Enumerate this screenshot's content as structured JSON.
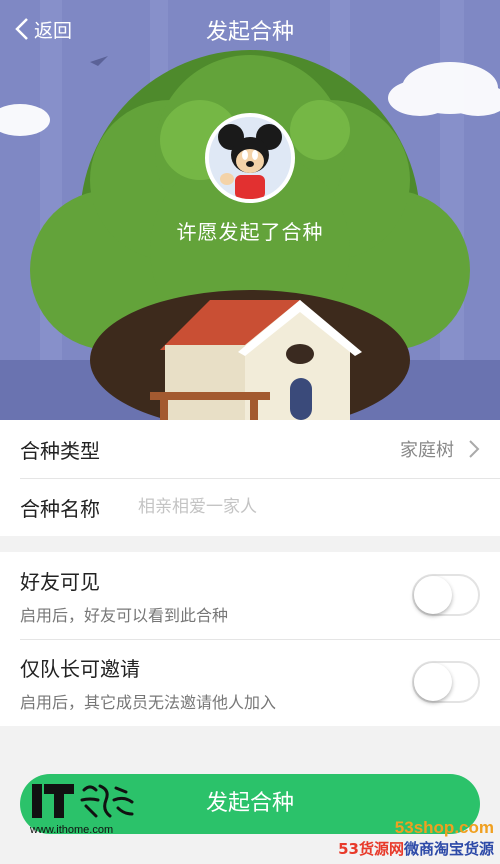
{
  "header": {
    "back_label": "返回",
    "title": "发起合种"
  },
  "hero": {
    "initiator_text": "许愿发起了合种"
  },
  "form": {
    "type_label": "合种类型",
    "type_value": "家庭树",
    "name_label": "合种名称",
    "name_placeholder": "相亲相爱一家人"
  },
  "settings": [
    {
      "title": "好友可见",
      "description": "启用后，好友可以看到此合种",
      "enabled": false
    },
    {
      "title": "仅队长可邀请",
      "description": "启用后，其它成员无法邀请他人加入",
      "enabled": false
    }
  ],
  "submit_label": "发起合种",
  "watermarks": {
    "ithome_logo": "IT之家",
    "ithome_url": "www.ithome.com",
    "site53_url": "53shop.com",
    "site53_name_a": "53货源网",
    "site53_name_b": "微商淘宝货源"
  },
  "colors": {
    "accent": "#2bc26a",
    "hero_sky": "#7f88c4",
    "tree": "#63a33a"
  }
}
